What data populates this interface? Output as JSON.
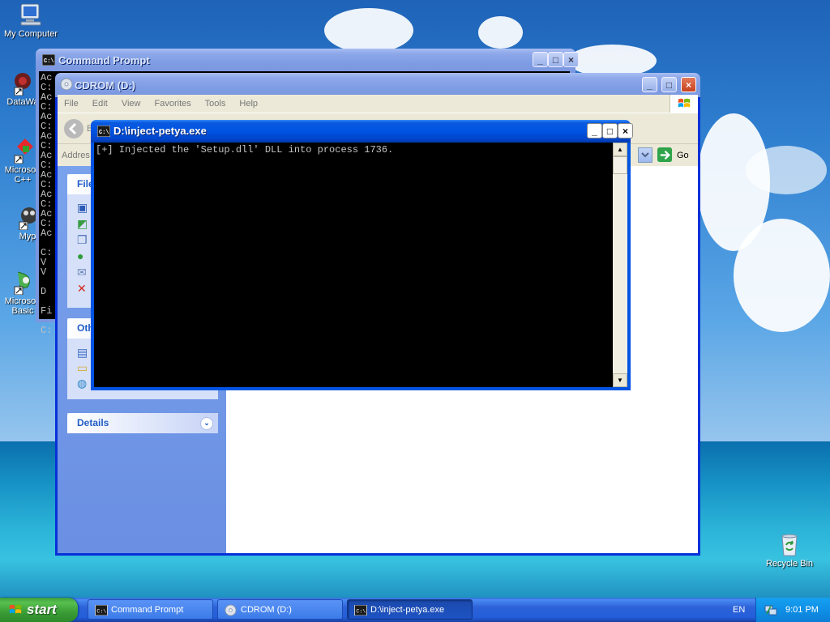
{
  "desktop": {
    "icons": [
      {
        "label": "My Computer",
        "icon": "my-computer-icon"
      },
      {
        "label": "DataWa",
        "icon": "datawatch-icon"
      },
      {
        "label": "Microsoft\nC++",
        "label_line1": "Microsoft",
        "label_line2": "C++",
        "icon": "visual-cpp-icon"
      },
      {
        "label": "Myp",
        "icon": "mypaint-icon"
      },
      {
        "label": "Microsoft\nBasic",
        "label_line1": "Microsoft",
        "label_line2": "Basic",
        "icon": "visual-basic-icon"
      },
      {
        "label": "Recycle Bin",
        "icon": "recycle-bin-icon"
      }
    ]
  },
  "cmd_window": {
    "title": "Command Prompt",
    "visible_lines": [
      "Ac",
      "C:",
      "Ac",
      "C:",
      "Ac",
      "C:",
      "Ac",
      "C:",
      "Ac",
      "C:",
      "Ac",
      "C:",
      "Ac",
      "C:",
      "Ac",
      "C:",
      "Ac",
      "",
      "C:",
      "V",
      "V",
      "",
      "D",
      "",
      "Fi",
      "",
      "C:"
    ]
  },
  "explorer": {
    "title": "CDROM (D:)",
    "menu": [
      "File",
      "Edit",
      "View",
      "Favorites",
      "Tools",
      "Help"
    ],
    "back_label": "B",
    "address_label": "Addres",
    "go_label": "Go",
    "file_tasks_header": "File",
    "other_places_header": "Oth",
    "details_header": "Details"
  },
  "inject_window": {
    "title": "D:\\inject-petya.exe",
    "output": "[+] Injected the 'Setup.dll' DLL into process 1736."
  },
  "taskbar": {
    "start_label": "start",
    "tasks": [
      {
        "label": "Command Prompt",
        "icon": "cmd-icon",
        "active": false
      },
      {
        "label": "CDROM (D:)",
        "icon": "cdrom-icon",
        "active": false
      },
      {
        "label": "D:\\inject-petya.exe",
        "icon": "cmd-icon",
        "active": true
      }
    ],
    "language": "EN",
    "clock": "9:01 PM"
  }
}
